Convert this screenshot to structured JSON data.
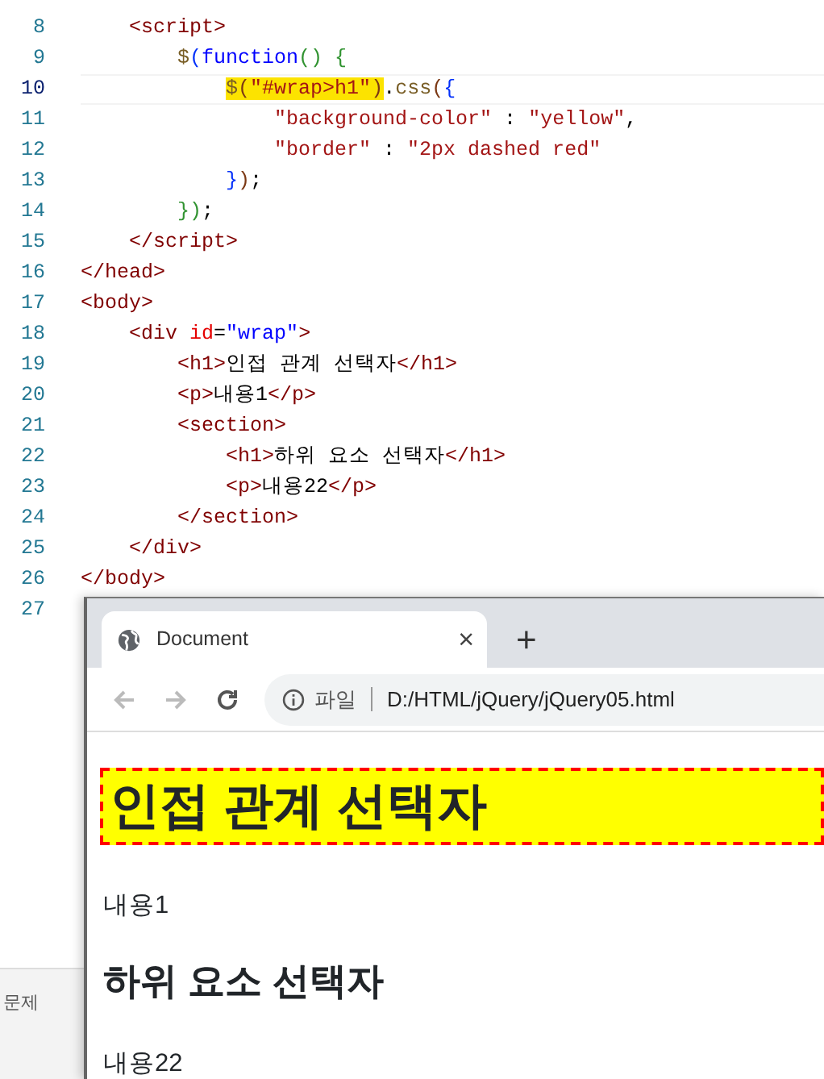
{
  "editor": {
    "lines": [
      {
        "number": "8",
        "current": false,
        "tokens": [
          {
            "kind": "tag",
            "text": "    <script>"
          }
        ]
      },
      {
        "number": "9",
        "current": false,
        "tokens": [
          {
            "kind": "func",
            "text": "        $"
          },
          {
            "kind": "b1",
            "text": "("
          },
          {
            "kind": "keyword",
            "text": "function"
          },
          {
            "kind": "b2",
            "text": "() {"
          }
        ]
      },
      {
        "number": "10",
        "current": true,
        "tokens": [
          {
            "kind": "func",
            "text": "            $",
            "highlighted": true
          },
          {
            "kind": "b3",
            "text": "(",
            "highlighted": true
          },
          {
            "kind": "string",
            "text": "\"#wrap>h1\"",
            "highlighted": true
          },
          {
            "kind": "b3",
            "text": ")",
            "highlighted": true
          },
          {
            "kind": "text",
            "text": "."
          },
          {
            "kind": "func",
            "text": "css"
          },
          {
            "kind": "b3",
            "text": "("
          },
          {
            "kind": "b1",
            "text": "{"
          }
        ]
      },
      {
        "number": "11",
        "current": false,
        "tokens": [
          {
            "kind": "string",
            "text": "                \"background-color\""
          },
          {
            "kind": "text",
            "text": " : "
          },
          {
            "kind": "string",
            "text": "\"yellow\""
          },
          {
            "kind": "text",
            "text": ","
          }
        ]
      },
      {
        "number": "12",
        "current": false,
        "tokens": [
          {
            "kind": "string",
            "text": "                \"border\""
          },
          {
            "kind": "text",
            "text": " : "
          },
          {
            "kind": "string",
            "text": "\"2px dashed red\""
          }
        ]
      },
      {
        "number": "13",
        "current": false,
        "tokens": [
          {
            "kind": "b1",
            "text": "            }"
          },
          {
            "kind": "b3",
            "text": ")"
          },
          {
            "kind": "text",
            "text": ";"
          }
        ]
      },
      {
        "number": "14",
        "current": false,
        "tokens": [
          {
            "kind": "b2",
            "text": "        })"
          },
          {
            "kind": "text",
            "text": ";"
          }
        ]
      },
      {
        "number": "15",
        "current": false,
        "tokens": [
          {
            "kind": "tag",
            "text": "    </script>"
          }
        ]
      },
      {
        "number": "16",
        "current": false,
        "tokens": [
          {
            "kind": "tag",
            "text": "</head>"
          }
        ]
      },
      {
        "number": "17",
        "current": false,
        "tokens": [
          {
            "kind": "tag",
            "text": "<body>"
          }
        ]
      },
      {
        "number": "18",
        "current": false,
        "tokens": [
          {
            "kind": "tag",
            "text": "    <div "
          },
          {
            "kind": "attr",
            "text": "id"
          },
          {
            "kind": "text",
            "text": "="
          },
          {
            "kind": "value",
            "text": "\"wrap\""
          },
          {
            "kind": "tag",
            "text": ">"
          }
        ]
      },
      {
        "number": "19",
        "current": false,
        "tokens": [
          {
            "kind": "tag",
            "text": "        <h1>"
          },
          {
            "kind": "text",
            "text": "인접 관계 선택자"
          },
          {
            "kind": "tag",
            "text": "</h1>"
          }
        ]
      },
      {
        "number": "20",
        "current": false,
        "tokens": [
          {
            "kind": "tag",
            "text": "        <p>"
          },
          {
            "kind": "text",
            "text": "내용1"
          },
          {
            "kind": "tag",
            "text": "</p>"
          }
        ]
      },
      {
        "number": "21",
        "current": false,
        "tokens": [
          {
            "kind": "tag",
            "text": "        <section>"
          }
        ]
      },
      {
        "number": "22",
        "current": false,
        "tokens": [
          {
            "kind": "tag",
            "text": "            <h1>"
          },
          {
            "kind": "text",
            "text": "하위 요소 선택자"
          },
          {
            "kind": "tag",
            "text": "</h1>"
          }
        ]
      },
      {
        "number": "23",
        "current": false,
        "tokens": [
          {
            "kind": "tag",
            "text": "            <p>"
          },
          {
            "kind": "text",
            "text": "내용22"
          },
          {
            "kind": "tag",
            "text": "</p>"
          }
        ]
      },
      {
        "number": "24",
        "current": false,
        "tokens": [
          {
            "kind": "tag",
            "text": "        </section>"
          }
        ]
      },
      {
        "number": "25",
        "current": false,
        "tokens": [
          {
            "kind": "tag",
            "text": "    </div>"
          }
        ]
      },
      {
        "number": "26",
        "current": false,
        "tokens": [
          {
            "kind": "tag",
            "text": "</body>"
          }
        ]
      },
      {
        "number": "27",
        "current": false
      }
    ]
  },
  "bottom_panel": {
    "tabs": [
      {
        "label": "문제"
      }
    ]
  },
  "browser": {
    "tab": {
      "title": "Document",
      "close": "×"
    },
    "new_tab": "+",
    "nav_buttons": [
      {
        "kind": "back",
        "disabled": true
      },
      {
        "kind": "forward",
        "disabled": true
      },
      {
        "kind": "reload",
        "disabled": false
      }
    ],
    "address": {
      "scheme_label": "파일",
      "url": "D:/HTML/jQuery/jQuery05.html"
    },
    "page": {
      "blocks": [
        {
          "kind": "h1",
          "text": "인접 관계 선택자",
          "styled": true
        },
        {
          "kind": "p",
          "text": "내용1",
          "styled": false
        },
        {
          "kind": "h2",
          "text": "하위 요소 선택자",
          "styled": false
        },
        {
          "kind": "p",
          "text": "내용22",
          "styled": false
        }
      ]
    }
  }
}
